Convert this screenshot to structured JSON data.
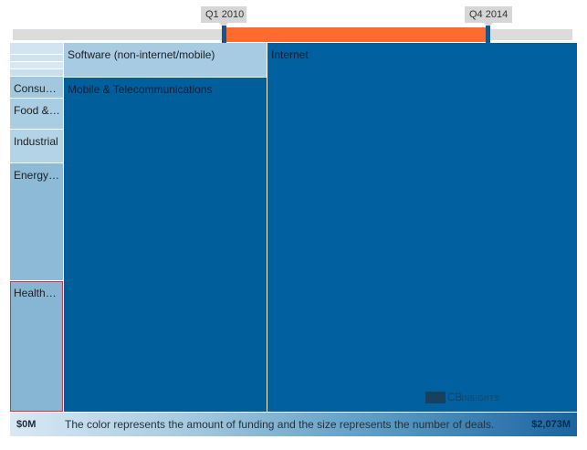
{
  "slider": {
    "start_label": "Q1 2010",
    "end_label": "Q4 2014"
  },
  "legend": {
    "min_label": "$0M",
    "max_label": "$2,073M",
    "caption": "The color represents the amount of funding and the size represents the number of deals."
  },
  "watermark": {
    "text": "CB",
    "subtext": "INSIGHTS"
  },
  "colors": {
    "slider_range": "#ff6a2f",
    "slider_handle": "#15578c",
    "selected_outline": "#e0313b",
    "funding_low": "#d9e9f5",
    "funding_high": "#1a64a0"
  },
  "chart_data": {
    "type": "treemap",
    "size_measure": "number of deals",
    "color_measure": "amount of funding",
    "items": [
      {
        "label": "Internet",
        "shown_label": "Internet",
        "color": "#0060a0"
      },
      {
        "label": "Mobile & Telecommunications",
        "shown_label": "Mobile & Telecommunications",
        "color": "#005e9b"
      },
      {
        "label": "Software (non-internet/mobile)",
        "shown_label": "Software (non-internet/mobile)",
        "color": "#a6cbe2"
      },
      {
        "label": "Healthcare",
        "shown_label": "Health…",
        "color": "#86b6d3",
        "selected": true
      },
      {
        "label": "Energy",
        "shown_label": "Energy…",
        "color": "#8dbbd7"
      },
      {
        "label": "Industrial",
        "shown_label": "Industrial",
        "color": "#b3d3e7"
      },
      {
        "label": "Food",
        "shown_label": "Food &…",
        "color": "#a9cde2"
      },
      {
        "label": "Consumer",
        "shown_label": "Consu…",
        "color": "#a2c8df"
      },
      {
        "label": "",
        "shown_label": "",
        "color": "#d2e4f1"
      },
      {
        "label": "",
        "shown_label": "",
        "color": "#cfe2f0"
      },
      {
        "label": "",
        "shown_label": "",
        "color": "#d7e8f3"
      },
      {
        "label": "",
        "shown_label": "",
        "color": "#c9dfee"
      }
    ]
  }
}
